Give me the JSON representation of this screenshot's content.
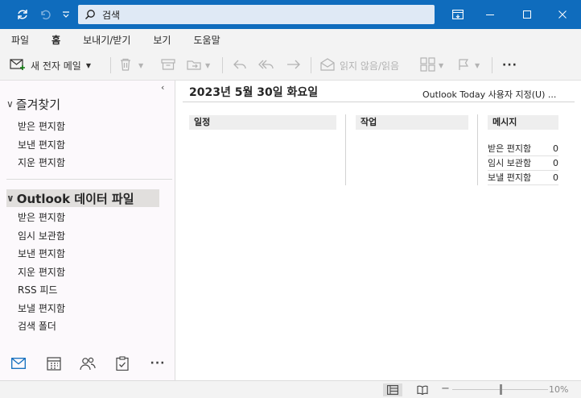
{
  "titlebar": {
    "search_placeholder": "검색"
  },
  "menu": [
    {
      "label": "파일",
      "active": false
    },
    {
      "label": "홈",
      "active": true
    },
    {
      "label": "보내기/받기",
      "active": false
    },
    {
      "label": "보기",
      "active": false
    },
    {
      "label": "도움말",
      "active": false
    }
  ],
  "toolbar": {
    "new_mail": "새 전자 메일",
    "read_unread": "읽지 않음/읽음"
  },
  "nav": {
    "favorites": {
      "title": "즐겨찾기",
      "folders": [
        "받은 편지함",
        "보낸 편지함",
        "지운 편지함"
      ]
    },
    "datafile": {
      "title": "Outlook 데이터 파일",
      "folders": [
        "받은 편지함",
        "임시 보관함",
        "보낸 편지함",
        "지운 편지함",
        "RSS 피드",
        "보낼 편지함",
        "검색 폴더"
      ]
    }
  },
  "today": {
    "date": "2023년 5월 30일 화요일",
    "customize": "Outlook Today 사용자 지정(U) ...",
    "calendar": "일정",
    "tasks": "작업",
    "messages": {
      "title": "메시지",
      "rows": [
        {
          "label": "받은 편지함",
          "count": "0"
        },
        {
          "label": "임시 보관함",
          "count": "0"
        },
        {
          "label": "보낼 편지함",
          "count": "0"
        }
      ]
    }
  },
  "status": {
    "zoom": "10%"
  },
  "colors": {
    "titlebar": "#0f6cbd",
    "accent": "#0f6cbd"
  }
}
